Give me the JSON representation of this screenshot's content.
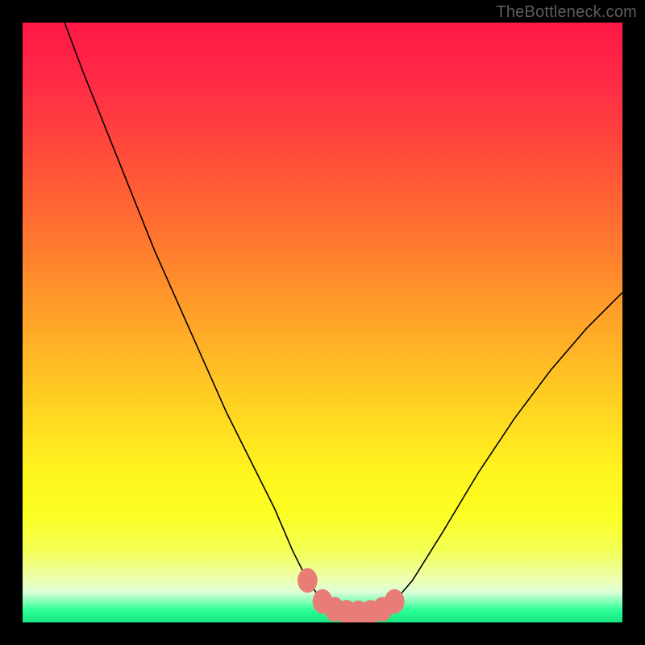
{
  "watermark": {
    "text": "TheBottleneck.com"
  },
  "colors": {
    "curve_stroke": "#000000",
    "marker_fill": "#e77d76",
    "marker_stroke": "#e77d76"
  },
  "chart_data": {
    "type": "line",
    "title": "",
    "xlabel": "",
    "ylabel": "",
    "xlim": [
      0,
      100
    ],
    "ylim": [
      0,
      100
    ],
    "grid": false,
    "legend": false,
    "series": [
      {
        "name": "bottleneck-curve",
        "x": [
          7,
          10,
          14,
          18,
          22,
          26,
          30,
          34,
          38,
          42,
          45,
          47.5,
          50,
          52,
          54,
          56,
          58,
          60,
          62,
          65,
          70,
          76,
          82,
          88,
          94,
          100
        ],
        "y": [
          100,
          92,
          82,
          72,
          62,
          53,
          44,
          35,
          27,
          19,
          12,
          7,
          3.5,
          2.2,
          1.7,
          1.6,
          1.7,
          2.2,
          3.5,
          7,
          15,
          25,
          34,
          42,
          49,
          55
        ]
      }
    ],
    "markers": {
      "name": "bottom-highlight",
      "x": [
        47.5,
        50,
        52,
        54,
        56,
        58,
        60,
        62
      ],
      "y": [
        7,
        3.5,
        2.2,
        1.7,
        1.6,
        1.7,
        2.2,
        3.5
      ],
      "rx": 1.6,
      "ry": 2.0
    }
  }
}
